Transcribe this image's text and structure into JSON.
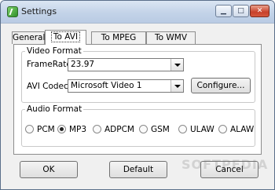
{
  "window": {
    "title": "Settings"
  },
  "tabs": [
    {
      "label": "General"
    },
    {
      "label": "To AVI"
    },
    {
      "label": "To MPEG"
    },
    {
      "label": "To WMV"
    }
  ],
  "video_format": {
    "legend": "Video Format",
    "framerate_label": "FrameRate:",
    "framerate_value": "23.97",
    "codec_label": "AVI Codec:",
    "codec_value": "Microsoft Video 1",
    "configure_label": "Configure..."
  },
  "audio_format": {
    "legend": "Audio Format",
    "options": [
      "PCM",
      "MP3",
      "ADPCM",
      "GSM",
      "ULAW",
      "ALAW"
    ],
    "selected": "MP3"
  },
  "buttons": {
    "ok": "OK",
    "default": "Default",
    "cancel": "Cancel"
  },
  "watermark": "SOFTPEDIA"
}
